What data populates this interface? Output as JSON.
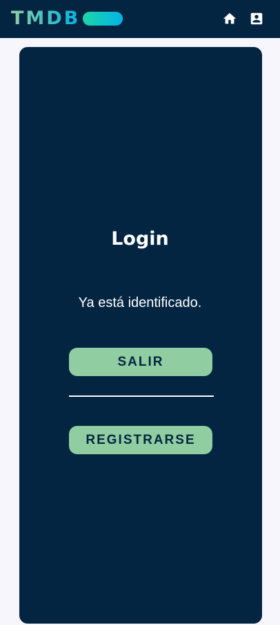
{
  "header": {
    "logo_text": "TMDB",
    "icons": [
      "home-icon",
      "profile-icon"
    ]
  },
  "login": {
    "title": "Login",
    "message": "Ya está identificado.",
    "logout_label": "SALIR",
    "register_label": "REGISTRARSE"
  },
  "colors": {
    "navy": "#032541",
    "green": "#90cea1",
    "blue": "#01b4e4",
    "page_bg": "#f8f6fd"
  }
}
